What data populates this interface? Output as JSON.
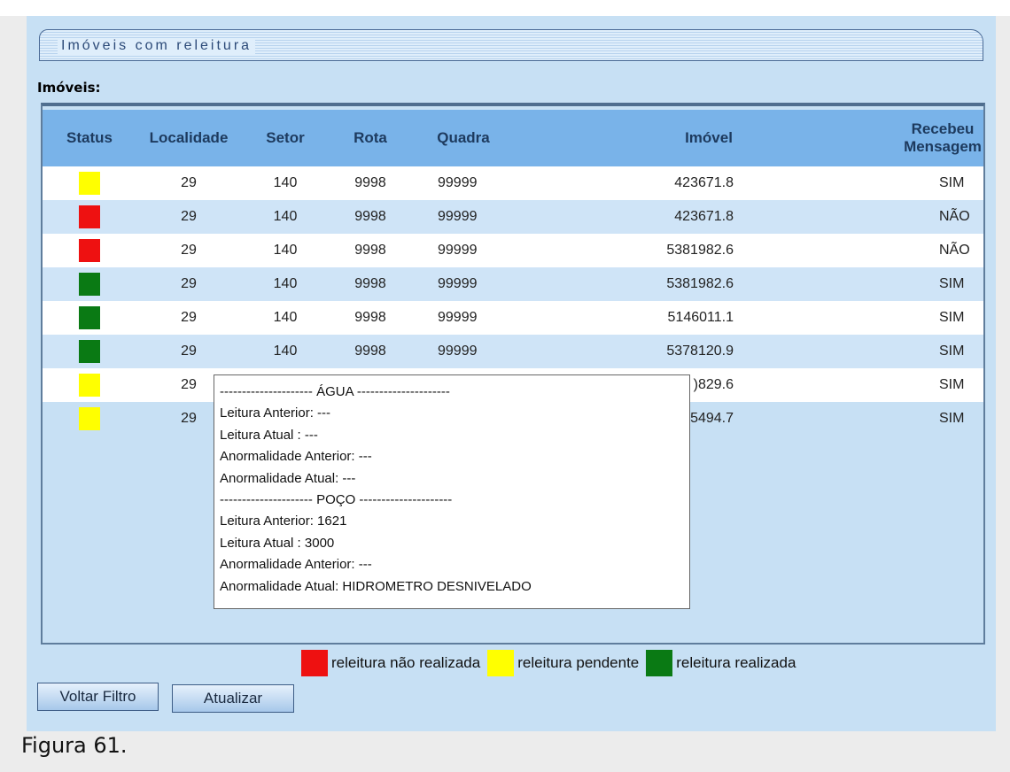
{
  "window": {
    "title": "Imóveis com releitura"
  },
  "section_label": "Imóveis:",
  "table": {
    "headers": [
      "Status",
      "Localidade",
      "Setor",
      "Rota",
      "Quadra",
      "Imóvel",
      "Recebeu Mensagem"
    ],
    "header_recebeu_line1": "Recebeu",
    "header_recebeu_line2": "Mensagem",
    "rows": [
      {
        "status": "yellow",
        "localidade": "29",
        "setor": "140",
        "rota": "9998",
        "quadra": "99999",
        "imovel": "423671.8",
        "recebeu": "SIM"
      },
      {
        "status": "red",
        "localidade": "29",
        "setor": "140",
        "rota": "9998",
        "quadra": "99999",
        "imovel": "423671.8",
        "recebeu": "NÃO"
      },
      {
        "status": "red",
        "localidade": "29",
        "setor": "140",
        "rota": "9998",
        "quadra": "99999",
        "imovel": "5381982.6",
        "recebeu": "NÃO"
      },
      {
        "status": "green",
        "localidade": "29",
        "setor": "140",
        "rota": "9998",
        "quadra": "99999",
        "imovel": "5381982.6",
        "recebeu": "SIM"
      },
      {
        "status": "green",
        "localidade": "29",
        "setor": "140",
        "rota": "9998",
        "quadra": "99999",
        "imovel": "5146011.1",
        "recebeu": "SIM"
      },
      {
        "status": "green",
        "localidade": "29",
        "setor": "140",
        "rota": "9998",
        "quadra": "99999",
        "imovel": "5378120.9",
        "recebeu": "SIM"
      },
      {
        "status": "yellow",
        "localidade": "29",
        "setor": "",
        "rota": "",
        "quadra": "",
        "imovel": ")829.6",
        "recebeu": "SIM"
      },
      {
        "status": "yellow",
        "localidade": "29",
        "setor": "",
        "rota": "",
        "quadra": "",
        "imovel": "5494.7",
        "recebeu": "SIM"
      }
    ]
  },
  "tooltip": {
    "lines": [
      "--------------------- ÁGUA ---------------------",
      "Leitura Anterior: ---",
      "Leitura Atual : ---",
      "Anormalidade Anterior: ---",
      "Anormalidade Atual: ---",
      "--------------------- POÇO ---------------------",
      "Leitura Anterior: 1621",
      "Leitura Atual : 3000",
      "Anormalidade Anterior: ---",
      "Anormalidade Atual: HIDROMETRO DESNIVELADO"
    ]
  },
  "legend": [
    {
      "color": "#ee1111",
      "label": "releitura não realizada"
    },
    {
      "color": "#ffff00",
      "label": "releitura pendente"
    },
    {
      "color": "#0a7a14",
      "label": "releitura realizada"
    }
  ],
  "buttons": {
    "voltar": "Voltar Filtro",
    "atualizar": "Atualizar"
  },
  "status_colors": {
    "red": "#ee1111",
    "yellow": "#ffff00",
    "green": "#0a7a14"
  },
  "caption": "Figura 61."
}
